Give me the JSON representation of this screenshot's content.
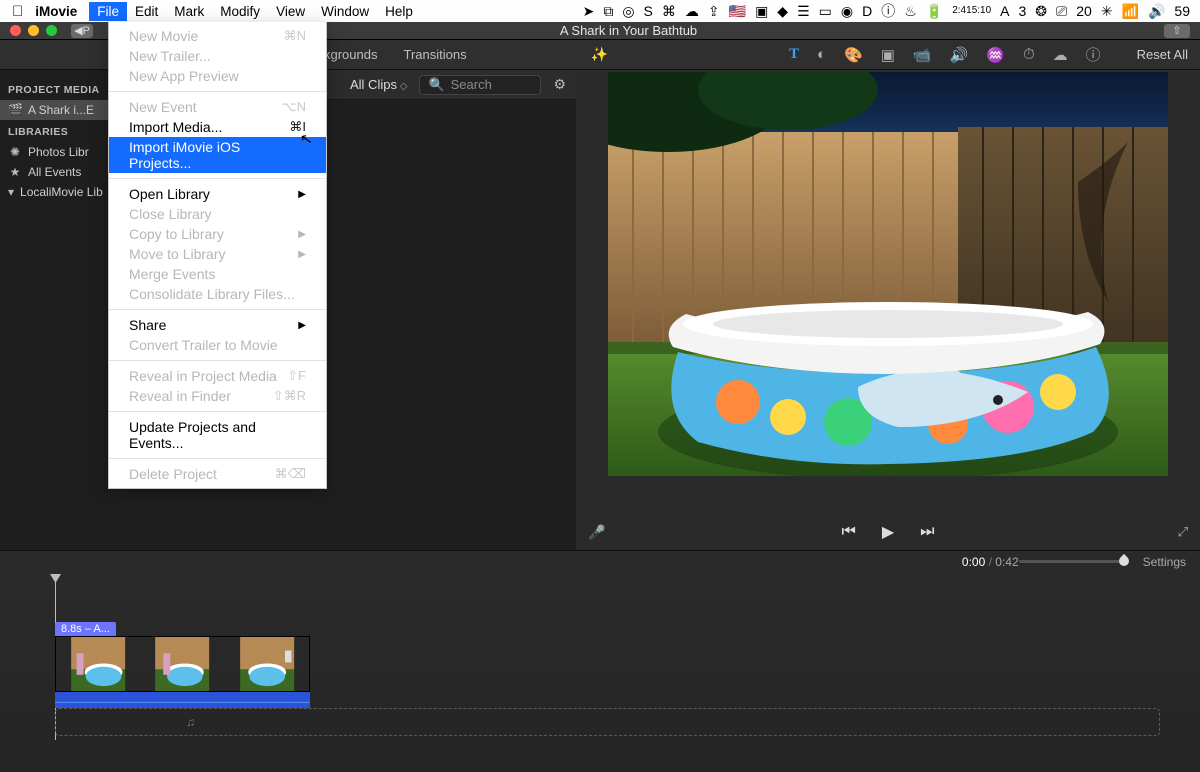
{
  "menubar": {
    "app": "iMovie",
    "items": [
      "File",
      "Edit",
      "Mark",
      "Modify",
      "View",
      "Window",
      "Help"
    ],
    "active_index": 0,
    "clock_time": "2:41",
    "clock_sub": "5:10",
    "extra_right": "59"
  },
  "dropdown": {
    "rows": [
      {
        "label": "New Movie",
        "shortcut": "⌘N",
        "disabled": true
      },
      {
        "label": "New Trailer...",
        "disabled": true
      },
      {
        "label": "New App Preview",
        "disabled": true
      },
      {
        "sep": true
      },
      {
        "label": "New Event",
        "shortcut": "⌥N",
        "disabled": true
      },
      {
        "label": "Import Media...",
        "shortcut": "⌘I"
      },
      {
        "label": "Import iMovie iOS Projects...",
        "hi": true
      },
      {
        "sep": true
      },
      {
        "label": "Open Library",
        "submenu": true
      },
      {
        "label": "Close Library",
        "disabled": true
      },
      {
        "label": "Copy to Library",
        "submenu": true,
        "disabled": true
      },
      {
        "label": "Move to Library",
        "submenu": true,
        "disabled": true
      },
      {
        "label": "Merge Events",
        "disabled": true
      },
      {
        "label": "Consolidate Library Files...",
        "disabled": true
      },
      {
        "sep": true
      },
      {
        "label": "Share",
        "submenu": true
      },
      {
        "label": "Convert Trailer to Movie",
        "disabled": true
      },
      {
        "sep": true
      },
      {
        "label": "Reveal in Project Media",
        "shortcut": "⇧F",
        "disabled": true
      },
      {
        "label": "Reveal in Finder",
        "shortcut": "⇧⌘R",
        "disabled": true
      },
      {
        "sep": true
      },
      {
        "label": "Update Projects and Events..."
      },
      {
        "sep": true
      },
      {
        "label": "Delete Project",
        "shortcut": "⌘⌫",
        "disabled": true
      }
    ]
  },
  "titlebar": {
    "title": "A Shark in Your Bathtub",
    "back": "P"
  },
  "toolbar": {
    "tabs": [
      "kgrounds",
      "Transitions"
    ],
    "reset": "Reset All"
  },
  "cliphdr": {
    "dropdown": "All Clips",
    "search_placeholder": "Search"
  },
  "sidebar": {
    "hdr1": "PROJECT MEDIA",
    "project": "A Shark i...E",
    "hdr2": "LIBRARIES",
    "items": [
      "Photos Libr",
      "All Events",
      "LocaliMovie Lib"
    ]
  },
  "time": {
    "current": "0:00",
    "total": "0:42",
    "settings": "Settings"
  },
  "clip": {
    "tag": "8.8s – A..."
  },
  "icons": {
    "apple": "",
    "loc": "➤",
    "dropbox": "⧉",
    "cc": "◎",
    "s": "S",
    "rail": "⌘",
    "cloud": "☁",
    "up": "⇪",
    "flag": "🇺🇸",
    "box": "▣",
    "ev": "◆",
    "menu": "☰",
    "screen": "▭",
    "rec": "◉",
    "d": "D",
    "info": "ⓘ",
    "flame": "♨",
    "bat": "🔋",
    "a": "A",
    "num": "3",
    "sp": "❂",
    "cast": "⎚",
    "cal": "20",
    "ast": "✳",
    "wifi": "📶",
    "vol": "🔊"
  }
}
